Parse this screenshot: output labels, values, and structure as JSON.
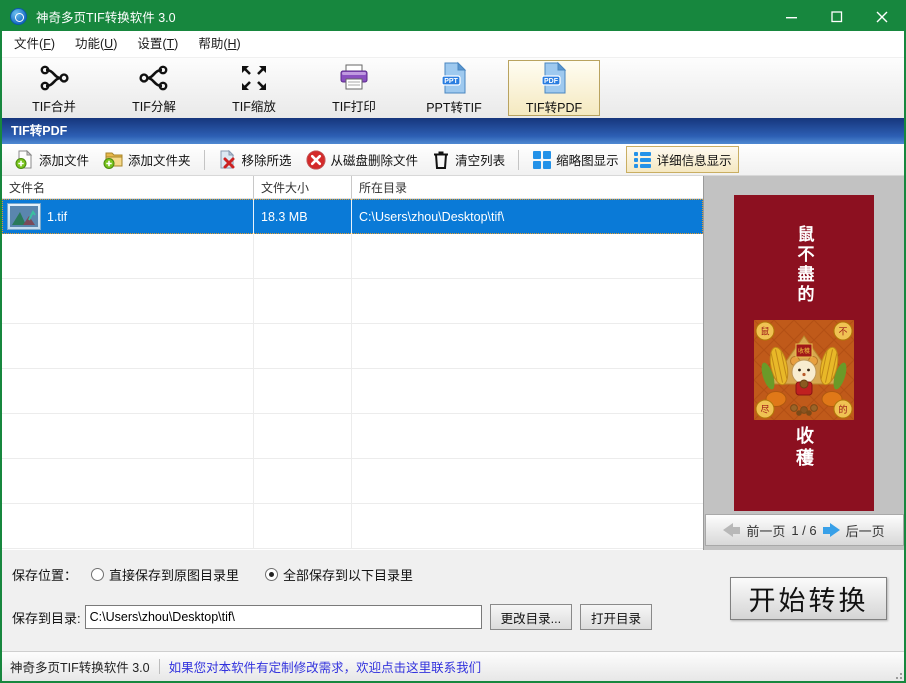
{
  "window": {
    "title": "神奇多页TIF转换软件 3.0"
  },
  "menu": {
    "items": [
      "文件(F)",
      "功能(U)",
      "设置(T)",
      "帮助(H)"
    ]
  },
  "toolbar": {
    "buttons": [
      {
        "label": "TIF合并",
        "icon": "merge-icon",
        "selected": false
      },
      {
        "label": "TIF分解",
        "icon": "split-icon",
        "selected": false
      },
      {
        "label": "TIF缩放",
        "icon": "scale-icon",
        "selected": false
      },
      {
        "label": "TIF打印",
        "icon": "printer-icon",
        "selected": false
      },
      {
        "label": "PPT转TIF",
        "icon": "ppt-doc-icon",
        "selected": false
      },
      {
        "label": "TIF转PDF",
        "icon": "pdf-doc-icon",
        "selected": true,
        "badge": "PDF"
      }
    ],
    "ppt_badge": "PPT",
    "pdf_badge": "PDF"
  },
  "section_header": {
    "label": "TIF转PDF"
  },
  "actionbar": {
    "buttons": [
      {
        "label": "添加文件",
        "icon": "add-file-icon"
      },
      {
        "label": "添加文件夹",
        "icon": "add-folder-icon"
      },
      {
        "label": "移除所选",
        "icon": "remove-selected-icon"
      },
      {
        "label": "从磁盘删除文件",
        "icon": "delete-from-disk-icon"
      },
      {
        "label": "清空列表",
        "icon": "clear-list-icon"
      },
      {
        "label": "缩略图显示",
        "icon": "thumbnail-view-icon"
      },
      {
        "label": "详细信息显示",
        "icon": "detail-view-icon",
        "selected": true
      }
    ]
  },
  "filelist": {
    "headers": [
      "文件名",
      "文件大小",
      "所在目录"
    ],
    "rows": [
      {
        "name": "1.tif",
        "size": "18.3 MB",
        "dir": "C:\\Users\\zhou\\Desktop\\tif\\",
        "selected": true
      }
    ]
  },
  "preview": {
    "poster": {
      "top_text": "鼠不盡的",
      "bottom_text": "收穫",
      "banner_text": "收穫",
      "corner_chars": [
        "鼠",
        "不",
        "尽",
        "的"
      ]
    },
    "pager": {
      "prev_label": "前一页",
      "page_indicator": "1 / 6",
      "next_label": "后一页"
    }
  },
  "save_options": {
    "location_label": "保存位置：",
    "radios": [
      {
        "label": "直接保存到原图目录里",
        "selected": false
      },
      {
        "label": "全部保存到以下目录里",
        "selected": true
      }
    ],
    "dir_label": "保存到目录:",
    "dir_value": "C:\\Users\\zhou\\Desktop\\tif\\",
    "change_dir_button": "更改目录...",
    "open_dir_button": "打开目录",
    "convert_button": "开始转换"
  },
  "statusbar": {
    "app_name": "神奇多页TIF转换软件 3.0",
    "link_text": "如果您对本软件有定制修改需求，欢迎点击这里联系我们"
  },
  "colors": {
    "titlebar_green": "#17873e",
    "selection_blue": "#0a7ad7",
    "caption_gradient_top": "#16367c",
    "caption_gradient_bottom": "#4e89d2",
    "selected_button_cream": "#f5e9c0",
    "poster_red": "#8c1020",
    "accent_blue": "#2492e8",
    "link_blue": "#3232dd"
  }
}
